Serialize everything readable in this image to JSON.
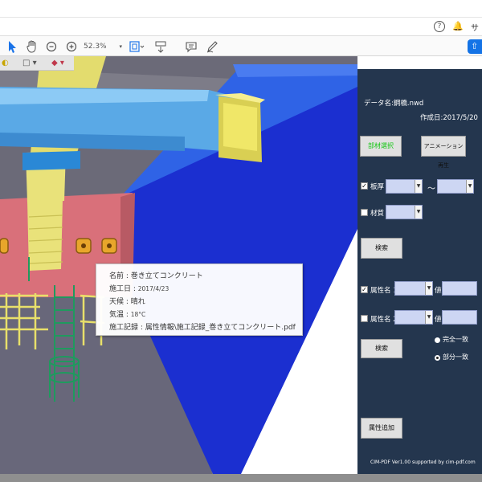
{
  "topbar": {
    "help_icon": "help-icon",
    "bell_icon": "bell-icon",
    "signin_label": "サ"
  },
  "toolbar": {
    "zoom_value": "52.3%",
    "zoom_caret": "▾",
    "icons": [
      "select-arrow-icon",
      "hand-icon",
      "zoom-out-icon",
      "zoom-in-icon",
      "fit-page-icon",
      "scroll-mode-icon",
      "comment-icon",
      "pen-icon",
      "share-icon"
    ]
  },
  "tooltip": {
    "name_label": "名前 : ",
    "name_value": "巻き立てコンクリート",
    "date_label": "施工日 : ",
    "date_value": "2017/4/23",
    "weather_label": "天候 : ",
    "weather_value": "晴れ",
    "temp_label": "気温 : ",
    "temp_value": "18°C",
    "record_label": "施工記録 : ",
    "record_value": "属性情報\\施工記録_巻き立てコンクリート.pdf"
  },
  "panel": {
    "data_name": "データ名:鋼橋.nwd",
    "created": "作成日:2017/5/20",
    "select_part_btn": "部材選択",
    "animation_btn": "アニメーション再生",
    "thickness_label": "板厚",
    "thickness_check": "✓",
    "tilde": "〜",
    "material_label": "材質",
    "search_btn": "検索",
    "attr1_label": "属性名 1",
    "attr1_check": "✓",
    "value_label": "値",
    "attr2_label": "属性名 2",
    "search_btn2": "検索",
    "exact_match": "完全一致",
    "partial_match": "部分一致",
    "add_attr_btn": "属性追加",
    "footer": "CIM-PDF Ver1.00 supported by cim-pdf.com"
  },
  "colors": {
    "panel_bg": "#24364e",
    "accent_blue": "#1473e6",
    "steel_blue": "#5aa9e6",
    "girder_yellow": "#e8e06a",
    "deck_blue": "#1d3fd8",
    "pier_red": "#d9707a",
    "stair_green": "#1f9a5e"
  }
}
